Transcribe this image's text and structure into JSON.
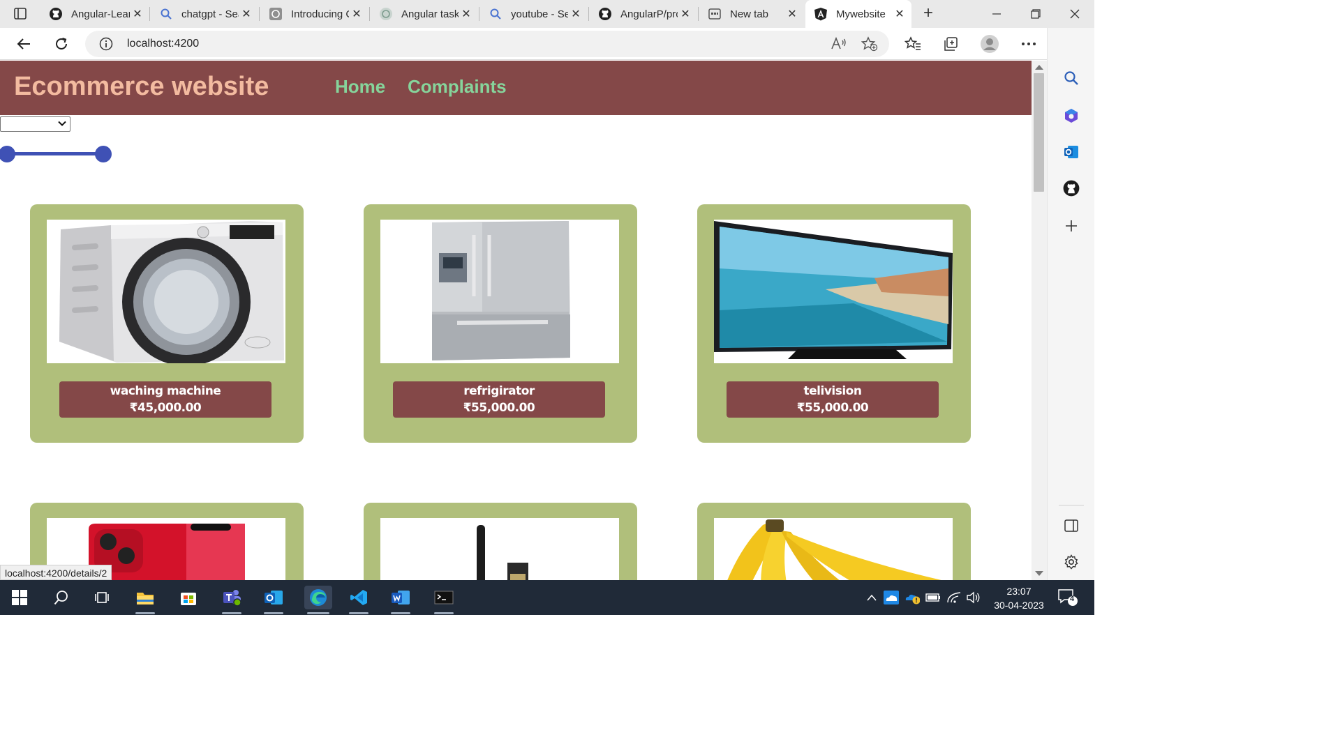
{
  "browser": {
    "tabs": [
      {
        "title": "Angular-Learning",
        "icon": "github-icon"
      },
      {
        "title": "chatgpt - Search",
        "icon": "search-icon"
      },
      {
        "title": "Introducing ChatGPT",
        "icon": "openai-icon"
      },
      {
        "title": "Angular task",
        "icon": "openai-icon"
      },
      {
        "title": "youtube - Search",
        "icon": "search-icon"
      },
      {
        "title": "AngularP/project",
        "icon": "github-icon"
      },
      {
        "title": "New tab",
        "icon": "newtab-icon"
      },
      {
        "title": "Mywebsite",
        "icon": "angular-icon"
      }
    ],
    "active_tab": 7,
    "url": "localhost:4200",
    "status_url": "localhost:4200/details/2"
  },
  "site": {
    "brand": "Ecommerce website",
    "nav": {
      "home": "Home",
      "complaints": "Complaints"
    },
    "filter_value": "",
    "price_slider": {
      "low": 0,
      "high": 1
    }
  },
  "products": [
    {
      "name": "waching machine",
      "price": "₹45,000.00",
      "image": "washing-machine"
    },
    {
      "name": "refrigirator",
      "price": "₹55,000.00",
      "image": "refrigerator"
    },
    {
      "name": "telivision",
      "price": "₹55,000.00",
      "image": "television"
    },
    {
      "name": "",
      "price": "",
      "image": "iphone"
    },
    {
      "name": "",
      "price": "",
      "image": "mascara"
    },
    {
      "name": "",
      "price": "",
      "image": "bananas"
    }
  ],
  "taskbar": {
    "time": "23:07",
    "date": "30-04-2023",
    "notifications": "4",
    "apps": [
      "windows-icon",
      "search-icon",
      "task-view-icon",
      "file-explorer-icon",
      "store-icon",
      "teams-icon",
      "outlook-icon",
      "edge-icon",
      "vscode-icon",
      "word-icon",
      "terminal-icon"
    ]
  },
  "colors": {
    "nav_bg": "#844848",
    "brand": "#f3bba0",
    "nav_link": "#86d49b",
    "card_bg": "#b0bf7b",
    "label_bg": "#844848",
    "slider": "#3f51b5"
  }
}
